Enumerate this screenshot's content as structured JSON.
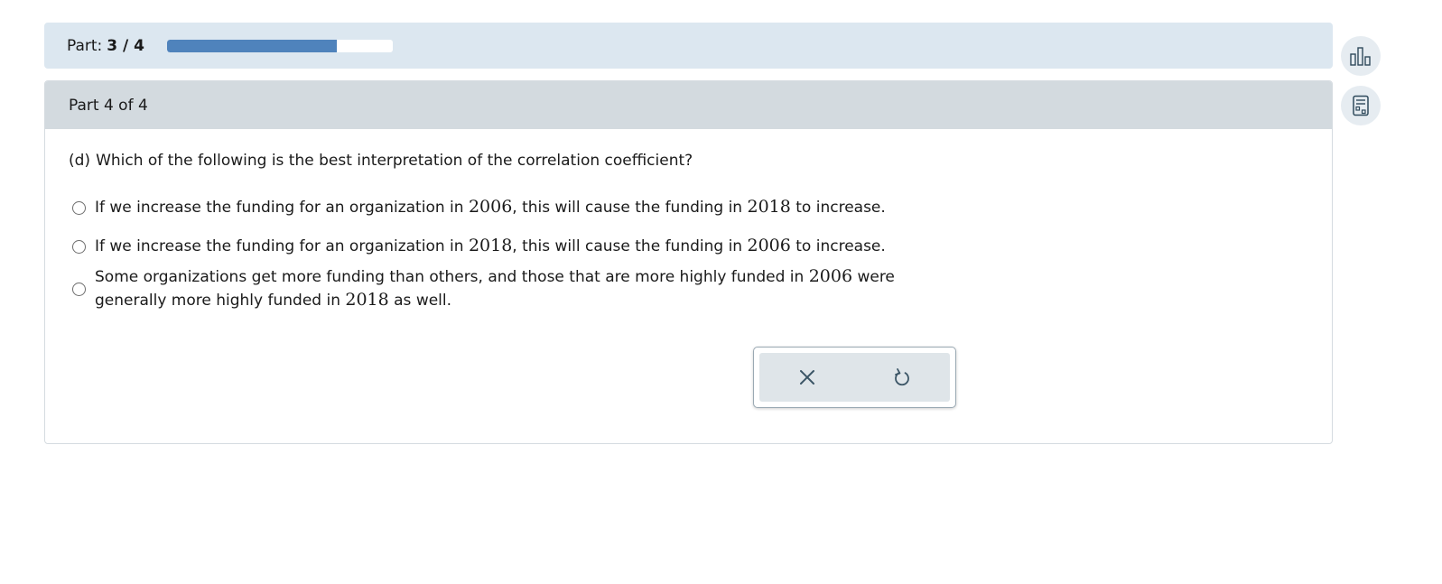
{
  "progress": {
    "label": "Part:",
    "value": "3 / 4",
    "fraction": 0.75,
    "fill_color": "#4f83bc"
  },
  "card": {
    "header": "Part 4 of 4",
    "question_label": "(d)",
    "question": "Which of the following is the best interpretation of the correlation coefficient?",
    "choices": [
      {
        "p1": "If we increase the funding for an organization in ",
        "y1": "2006",
        "p2": ", this will cause the funding in ",
        "y2": "2018",
        "p3": " to increase."
      },
      {
        "p1": "If we increase the funding for an organization in ",
        "y1": "2018",
        "p2": ", this will cause the funding in ",
        "y2": "2006",
        "p3": " to increase."
      },
      {
        "p1": "Some organizations get more funding than others, and those that are more highly funded in ",
        "y1": "2006",
        "p2": " were generally more highly funded in ",
        "y2": "2018",
        "p3": " as well."
      }
    ]
  },
  "actions": {
    "clear_icon": "close-icon",
    "undo_icon": "undo-icon"
  },
  "sidebar": {
    "icons": [
      "bar-chart-icon",
      "calculator-icon"
    ]
  }
}
